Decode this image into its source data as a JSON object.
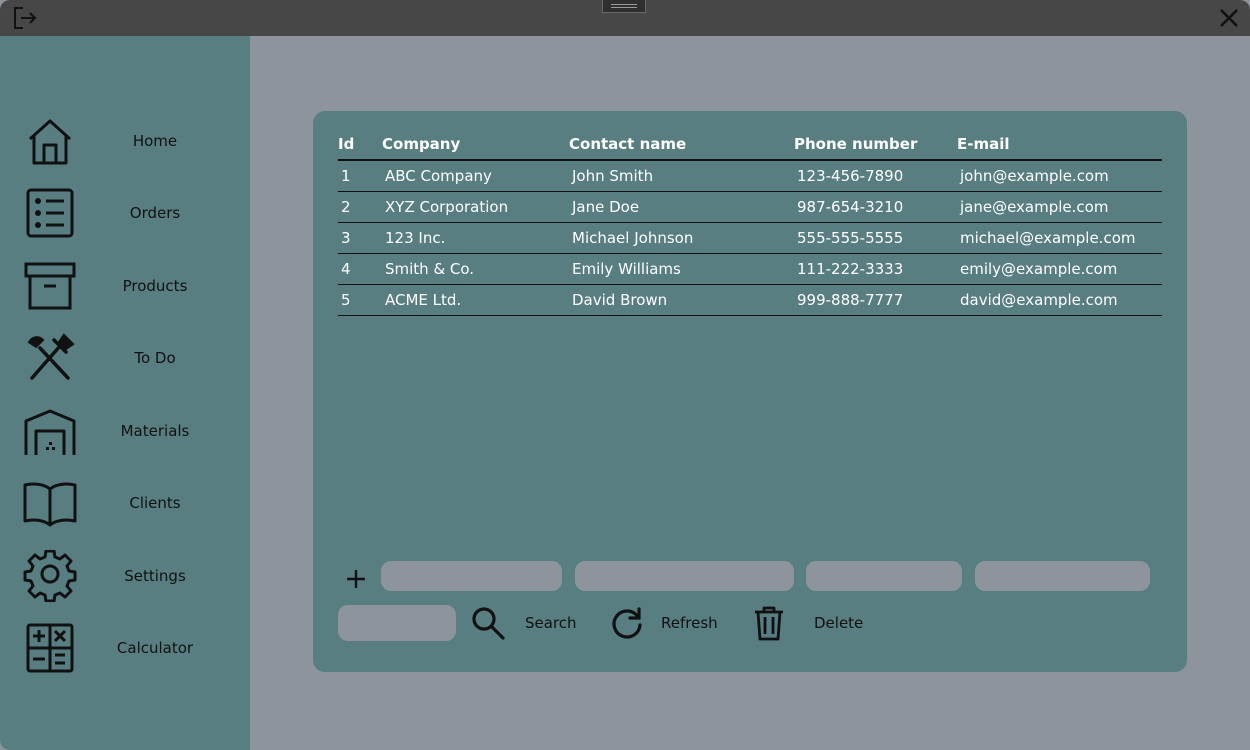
{
  "window": {
    "exit_icon": "exit-icon",
    "close_icon": "close-icon"
  },
  "sidebar": {
    "items": [
      {
        "label": "Home",
        "icon": "home-icon"
      },
      {
        "label": "Orders",
        "icon": "list-icon"
      },
      {
        "label": "Products",
        "icon": "archive-box-icon"
      },
      {
        "label": "To Do",
        "icon": "tools-icon"
      },
      {
        "label": "Materials",
        "icon": "warehouse-icon"
      },
      {
        "label": "Clients",
        "icon": "open-book-icon"
      },
      {
        "label": "Settings",
        "icon": "gear-icon"
      },
      {
        "label": "Calculator",
        "icon": "calculator-icon"
      }
    ]
  },
  "table": {
    "headers": {
      "id": "Id",
      "company": "Company",
      "contact": "Contact name",
      "phone": "Phone number",
      "email": "E-mail"
    },
    "rows": [
      {
        "id": "1",
        "company": "ABC Company",
        "contact": "John Smith",
        "phone": "123-456-7890",
        "email": "john@example.com"
      },
      {
        "id": "2",
        "company": "XYZ Corporation",
        "contact": "Jane Doe",
        "phone": "987-654-3210",
        "email": "jane@example.com"
      },
      {
        "id": "3",
        "company": "123 Inc.",
        "contact": "Michael Johnson",
        "phone": "555-555-5555",
        "email": "michael@example.com"
      },
      {
        "id": "4",
        "company": "Smith & Co.",
        "contact": "Emily Williams",
        "phone": "111-222-3333",
        "email": "emily@example.com"
      },
      {
        "id": "5",
        "company": "ACME Ltd.",
        "contact": "David Brown",
        "phone": "999-888-7777",
        "email": "david@example.com"
      }
    ]
  },
  "form": {
    "company_value": "",
    "contact_value": "",
    "phone_value": "",
    "email_value": "",
    "search_value": ""
  },
  "toolbar": {
    "search_label": "Search",
    "refresh_label": "Refresh",
    "delete_label": "Delete"
  },
  "colors": {
    "background": "#8e949c",
    "titlebar": "#474747",
    "sidebar": "#587e81",
    "panel": "#587e81"
  }
}
